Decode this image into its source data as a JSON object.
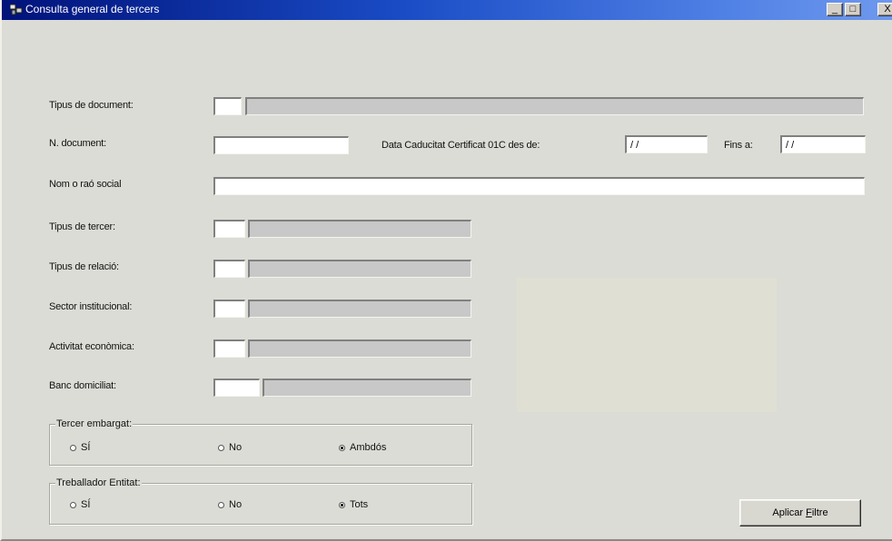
{
  "window": {
    "title": "Consulta general de tercers",
    "buttons": {
      "minimize": "_",
      "maximize": "□",
      "close": "X"
    }
  },
  "form": {
    "tipus_document": {
      "label": "Tipus de document:",
      "code": "",
      "description": ""
    },
    "n_document": {
      "label": "N. document:",
      "value": ""
    },
    "data_caducitat": {
      "label": "Data Caducitat Certificat 01C des de:",
      "value": "/ /"
    },
    "fins_a": {
      "label": "Fins a:",
      "value": "/ /"
    },
    "nom": {
      "label": "Nom o raó social",
      "value": ""
    },
    "tipus_tercer": {
      "label": "Tipus de tercer:",
      "code": "",
      "description": ""
    },
    "tipus_relacio": {
      "label": "Tipus de relació:",
      "code": "",
      "description": ""
    },
    "sector": {
      "label": "Sector institucional:",
      "code": "",
      "description": ""
    },
    "activitat": {
      "label": "Activitat econòmica:",
      "code": "",
      "description": ""
    },
    "banc": {
      "label": "Banc domiciliat:",
      "code": "",
      "description": ""
    }
  },
  "groups": {
    "tercer_embargat": {
      "title": "Tercer embargat:",
      "options": [
        "SÍ",
        "No",
        "Ambdós"
      ],
      "selected": "Ambdós"
    },
    "treballador_entitat": {
      "title": "Treballador Entitat:",
      "options": [
        "SÍ",
        "No",
        "Tots"
      ],
      "selected": "Tots"
    }
  },
  "actions": {
    "apply_prefix": "Aplicar ",
    "apply_hotkey": "F",
    "apply_suffix": "iltre"
  },
  "colors": {
    "titlebar_start": "#00127a",
    "titlebar_end": "#6e99ee",
    "window_bg": "#dcdcd6",
    "panel_bg": "#e0dfd4"
  }
}
